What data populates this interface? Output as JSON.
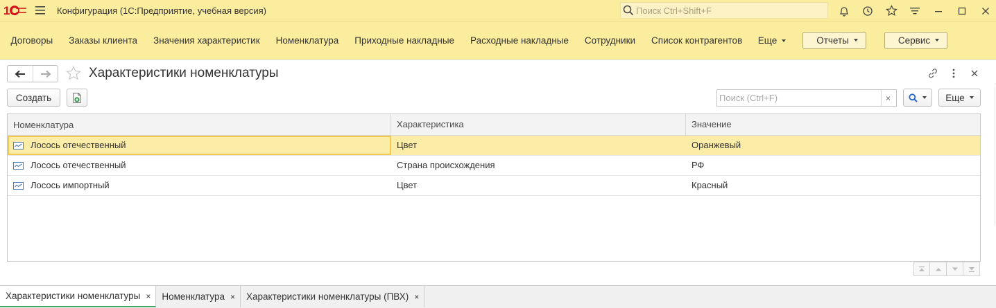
{
  "titlebar": {
    "logo_text": "1С",
    "app_title": "Конфигурация  (1С:Предприятие, учебная версия)",
    "search_placeholder": "Поиск Ctrl+Shift+F"
  },
  "sections": {
    "links": [
      {
        "label": "Договоры"
      },
      {
        "label": "Заказы клиента"
      },
      {
        "label": "Значения характеристик"
      },
      {
        "label": "Номенклатура"
      },
      {
        "label": "Приходные накладные"
      },
      {
        "label": "Расходные накладные"
      },
      {
        "label": "Сотрудники"
      },
      {
        "label": "Список контрагентов"
      }
    ],
    "more_label": "Еще",
    "reports_label": "Отчеты",
    "service_label": "Сервис"
  },
  "form": {
    "title": "Характеристики номенклатуры",
    "create_label": "Создать",
    "search_placeholder": "Поиск (Ctrl+F)",
    "search_clear": "×",
    "more_label": "Еще"
  },
  "table": {
    "columns": [
      "Номенклатура",
      "Характеристика",
      "Значение"
    ],
    "rows": [
      {
        "item": "Лосось отечественный",
        "characteristic": "Цвет",
        "value": "Оранжевый",
        "selected": true
      },
      {
        "item": "Лосось отечественный",
        "characteristic": "Страна происхождения",
        "value": "РФ",
        "selected": false
      },
      {
        "item": "Лосось импортный",
        "characteristic": "Цвет",
        "value": "Красный",
        "selected": false
      }
    ]
  },
  "tabs": [
    {
      "label": "Характеристики номенклатуры",
      "close": "×",
      "active": true
    },
    {
      "label": "Номенклатура",
      "close": "×",
      "active": false
    },
    {
      "label": "Характеристики номенклатуры (ПВХ)",
      "close": "×",
      "active": false
    }
  ],
  "colors": {
    "panel_bg": "#fbed9e",
    "selected_row": "#fbeca8",
    "logo_red": "#d4161c",
    "active_tab_accent": "#46a463"
  },
  "icons": {
    "menu": "hamburger-icon",
    "search": "search-icon",
    "notifications": "bell-icon",
    "history": "history-icon",
    "favorites": "star-icon",
    "functions": "funnel-menu-icon",
    "minimize": "minimize-icon",
    "maximize": "maximize-icon",
    "close": "close-icon",
    "link": "link-icon",
    "kebab": "kebab-icon",
    "row_item": "catalog-item-icon"
  }
}
